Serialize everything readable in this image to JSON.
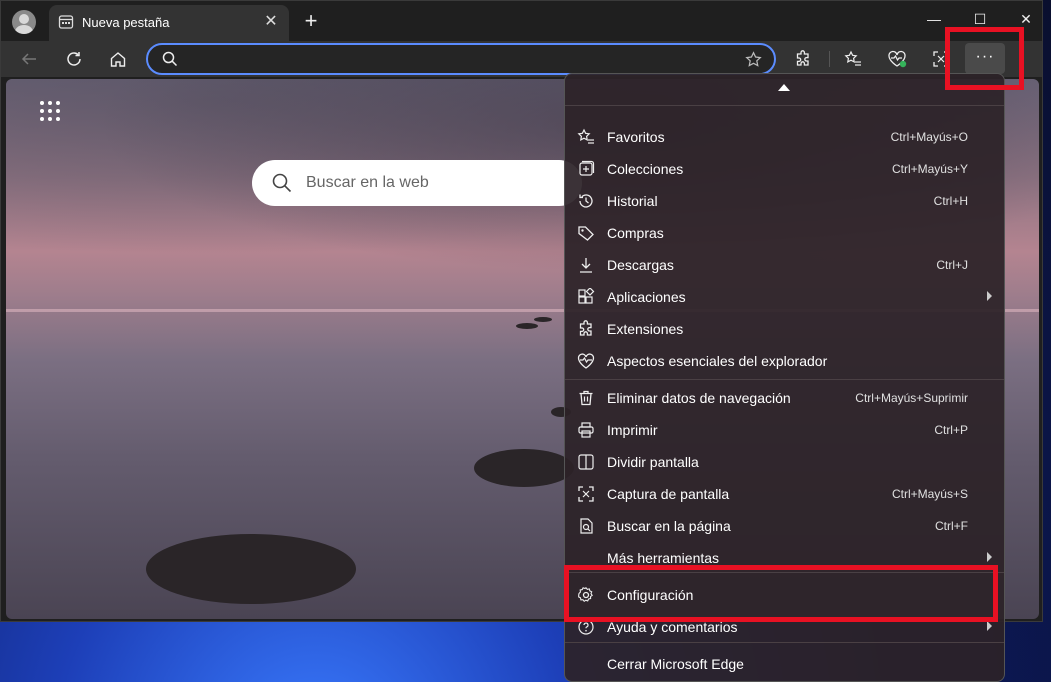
{
  "window": {
    "tab_title": "Nueva pestaña",
    "controls": {
      "minimize": "—",
      "maximize": "☐",
      "close": "✕"
    }
  },
  "toolbar": {
    "address_value": "",
    "more_label": "···"
  },
  "newtab_page": {
    "search_placeholder": "Buscar en la web"
  },
  "menu": {
    "groups": [
      [
        {
          "label": "Favoritos",
          "shortcut": "Ctrl+Mayús+O",
          "icon": "star-list-icon"
        },
        {
          "label": "Colecciones",
          "shortcut": "Ctrl+Mayús+Y",
          "icon": "collections-icon"
        },
        {
          "label": "Historial",
          "shortcut": "Ctrl+H",
          "icon": "history-icon"
        },
        {
          "label": "Compras",
          "shortcut": "",
          "icon": "tag-icon"
        },
        {
          "label": "Descargas",
          "shortcut": "Ctrl+J",
          "icon": "download-icon"
        },
        {
          "label": "Aplicaciones",
          "shortcut": "",
          "icon": "apps-icon",
          "submenu": true
        },
        {
          "label": "Extensiones",
          "shortcut": "",
          "icon": "puzzle-icon"
        },
        {
          "label": "Aspectos esenciales del explorador",
          "shortcut": "",
          "icon": "heart-pulse-icon"
        }
      ],
      [
        {
          "label": "Eliminar datos de navegación",
          "shortcut": "Ctrl+Mayús+Suprimir",
          "icon": "trash-icon"
        },
        {
          "label": "Imprimir",
          "shortcut": "Ctrl+P",
          "icon": "printer-icon"
        },
        {
          "label": "Dividir pantalla",
          "shortcut": "",
          "icon": "split-screen-icon"
        },
        {
          "label": "Captura de pantalla",
          "shortcut": "Ctrl+Mayús+S",
          "icon": "screenshot-icon"
        },
        {
          "label": "Buscar en la página",
          "shortcut": "Ctrl+F",
          "icon": "find-page-icon"
        },
        {
          "label": "Más herramientas",
          "shortcut": "",
          "icon": "",
          "submenu": true
        }
      ],
      [
        {
          "label": "Configuración",
          "shortcut": "",
          "icon": "gear-icon"
        },
        {
          "label": "Ayuda y comentarios",
          "shortcut": "",
          "icon": "help-icon",
          "submenu": true
        },
        {
          "label": "Cerrar Microsoft Edge",
          "shortcut": "",
          "icon": ""
        }
      ]
    ]
  },
  "colors": {
    "highlight": "#e81123",
    "address_focus": "#5b8cff"
  }
}
